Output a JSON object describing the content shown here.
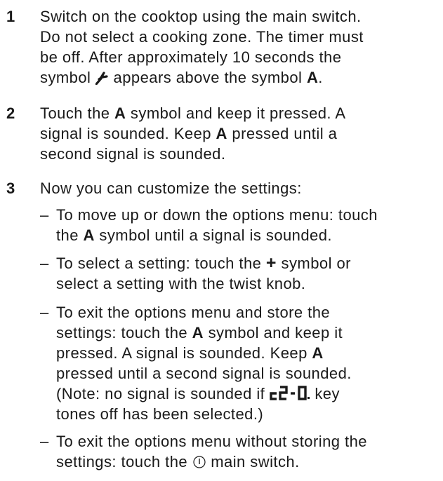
{
  "steps": [
    {
      "number": "1",
      "lines": [
        [
          "Switch on the cooktop using the main switch."
        ],
        [
          "Do not select a cooking zone. The timer must"
        ],
        [
          "be off. After approximately 10 seconds the"
        ],
        [
          "symbol ",
          "{wrench}",
          " appears above the symbol ",
          "{A}",
          "."
        ]
      ]
    },
    {
      "number": "2",
      "lines": [
        [
          "Touch the ",
          "{A}",
          " symbol and keep it pressed. A"
        ],
        [
          "signal is sounded. Keep ",
          "{A}",
          " pressed until a"
        ],
        [
          "second signal is sounded."
        ]
      ]
    },
    {
      "number": "3",
      "intro": "Now you can customize the settings:",
      "bullets": [
        [
          [
            "To move up or down the options menu: touch"
          ],
          [
            "the ",
            "{A}",
            " symbol until a signal is sounded."
          ]
        ],
        [
          [
            "To select a setting: touch the ",
            "{plus}",
            " symbol or"
          ],
          [
            "select a setting with the twist knob."
          ]
        ],
        [
          [
            "To exit the options menu and store the"
          ],
          [
            "settings: touch the ",
            "{A}",
            " symbol and keep it"
          ],
          [
            "pressed. A signal is sounded. Keep ",
            "{A}"
          ],
          [
            "pressed until a second signal is sounded."
          ],
          [
            "(Note: no signal is sounded if ",
            "{c2-0}",
            " key"
          ],
          [
            "tones off has been selected.)"
          ]
        ],
        [
          [
            "To exit the options menu without storing the"
          ],
          [
            "settings: touch the ",
            "{power}",
            " main switch."
          ]
        ]
      ]
    }
  ],
  "bullet_marker": "–",
  "symbols": {
    "A": "A",
    "plus": "+",
    "wrench": "wrench-icon",
    "power": "power-icon",
    "c2-0": "c2-0 display code"
  }
}
